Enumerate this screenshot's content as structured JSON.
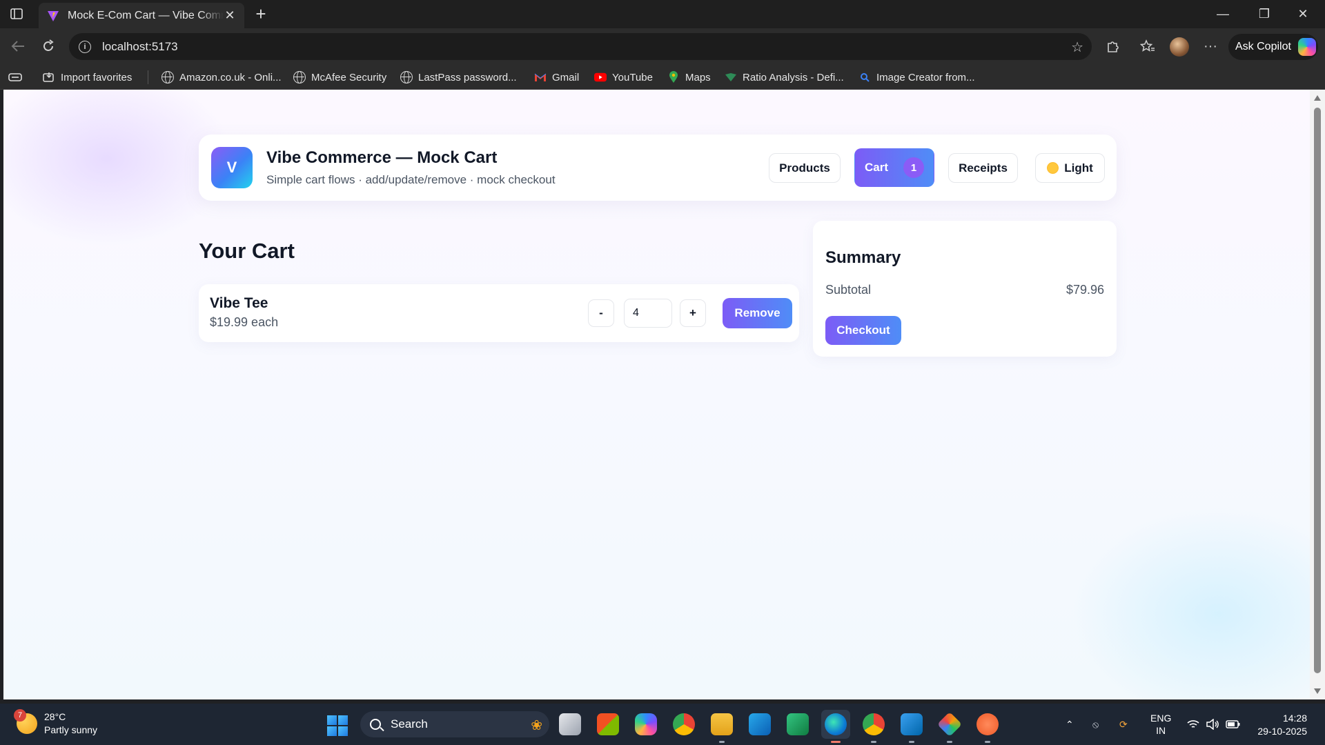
{
  "browser": {
    "tab_title": "Mock E-Com Cart — Vibe Commerce",
    "url": "localhost:5173",
    "ask_copilot": "Ask Copilot",
    "bookmarks": [
      {
        "label": "Import favorites",
        "icon": "import-icon"
      },
      {
        "label": "Amazon.co.uk - Onli...",
        "icon": "globe-icon"
      },
      {
        "label": "McAfee Security",
        "icon": "globe-icon"
      },
      {
        "label": "LastPass password...",
        "icon": "globe-icon"
      },
      {
        "label": "Gmail",
        "icon": "gmail-icon"
      },
      {
        "label": "YouTube",
        "icon": "youtube-icon"
      },
      {
        "label": "Maps",
        "icon": "maps-icon"
      },
      {
        "label": "Ratio Analysis - Defi...",
        "icon": "ratio-icon"
      },
      {
        "label": "Image Creator from...",
        "icon": "search-icon"
      }
    ]
  },
  "app": {
    "brand_letter": "V",
    "title": "Vibe Commerce — Mock Cart",
    "subtitle": "Simple cart flows · add/update/remove · mock checkout",
    "nav": {
      "products": "Products",
      "cart": "Cart",
      "cart_count": "1",
      "receipts": "Receipts",
      "theme": "Light"
    },
    "accent_start": "#7c5cf6",
    "accent_end": "#4f8df7"
  },
  "cart": {
    "heading": "Your Cart",
    "items": [
      {
        "name": "Vibe Tee",
        "price": "$19.99 each",
        "quantity": "4",
        "minus": "-",
        "plus": "+",
        "remove": "Remove"
      }
    ]
  },
  "summary": {
    "heading": "Summary",
    "subtotal_label": "Subtotal",
    "subtotal_value": "$79.96",
    "checkout": "Checkout"
  },
  "taskbar": {
    "weather_temp": "28°C",
    "weather_desc": "Partly sunny",
    "weather_badge": "7",
    "search": "Search",
    "lang_top": "ENG",
    "lang_bottom": "IN",
    "time": "14:28",
    "date": "29-10-2025"
  }
}
